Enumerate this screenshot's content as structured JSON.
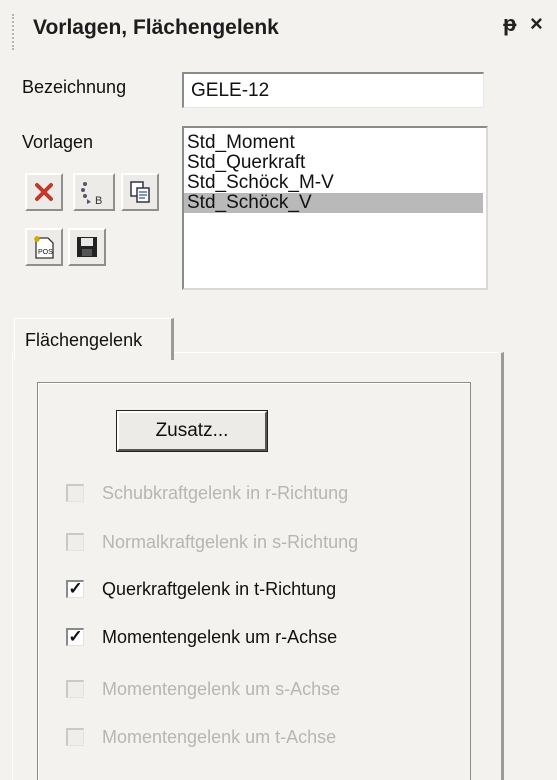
{
  "window": {
    "title": "Vorlagen, Flächengelenk",
    "pin_glyph": "ᵽ",
    "close_glyph": "×"
  },
  "bezeichnung": {
    "label": "Bezeichnung",
    "value": "GELE-12"
  },
  "vorlagen": {
    "label": "Vorlagen",
    "items": [
      "Std_Moment",
      "Std_Querkraft",
      "Std_Schöck_M-V",
      "Std_Schöck_V"
    ],
    "selected": "Std_Schöck_V"
  },
  "toolbar": {
    "icons": [
      "delete-icon",
      "rename-icon",
      "copy-icon",
      "new-pos-icon",
      "save-icon"
    ],
    "rename_sub": "B",
    "pos_text": "POS"
  },
  "tab": {
    "label": "Flächengelenk"
  },
  "zusatz_button": {
    "label": "Zusatz..."
  },
  "options": [
    {
      "label": "Schubkraftgelenk in r-Richtung",
      "checked": false,
      "enabled": false
    },
    {
      "label": "Normalkraftgelenk in s-Richtung",
      "checked": false,
      "enabled": false
    },
    {
      "label": "Querkraftgelenk in t-Richtung",
      "checked": true,
      "enabled": true
    },
    {
      "label": "Momentengelenk um r-Achse",
      "checked": true,
      "enabled": true
    },
    {
      "label": "Momentengelenk um s-Achse",
      "checked": false,
      "enabled": false
    },
    {
      "label": "Momentengelenk um t-Achse",
      "checked": false,
      "enabled": false
    }
  ],
  "colors": {
    "delete_red": "#c0392b",
    "selection_gray": "#b9b9b9",
    "disabled_text": "#b6b6b6"
  }
}
